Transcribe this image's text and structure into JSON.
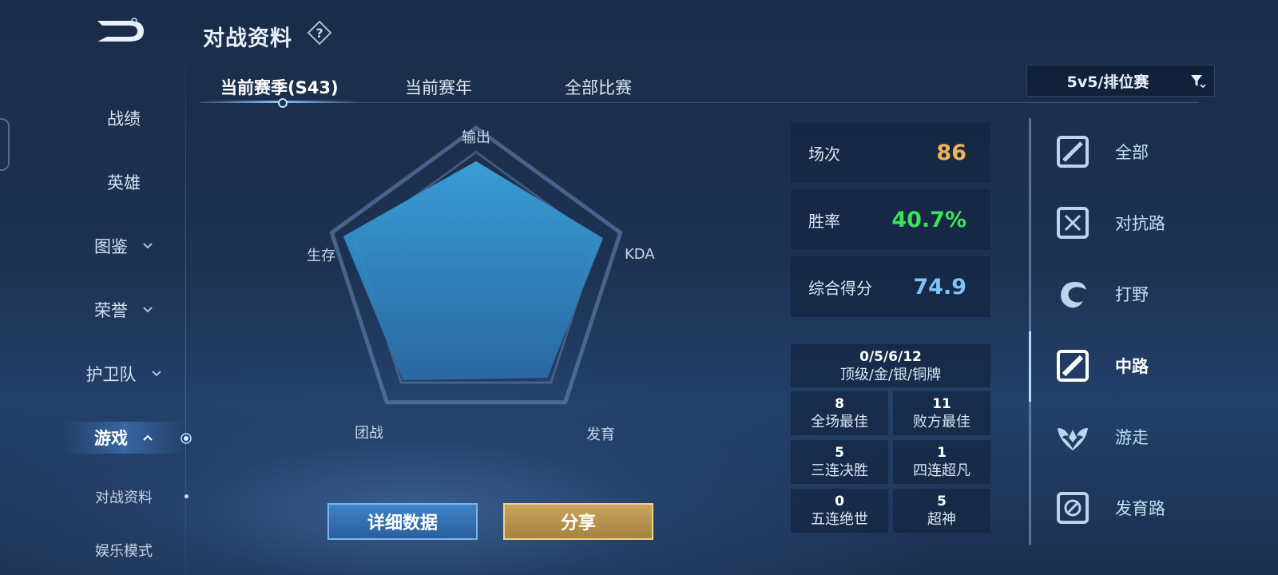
{
  "header": {
    "title": "对战资料"
  },
  "nav": {
    "items": [
      {
        "label": "战绩"
      },
      {
        "label": "英雄"
      },
      {
        "label": "图鉴"
      },
      {
        "label": "荣誉"
      },
      {
        "label": "护卫队"
      },
      {
        "label": "游戏"
      }
    ],
    "sub_items": [
      {
        "label": "对战资料"
      },
      {
        "label": "娱乐模式"
      }
    ]
  },
  "tabs": [
    {
      "label": "当前赛季(S43)"
    },
    {
      "label": "当前赛年"
    },
    {
      "label": "全部比赛"
    }
  ],
  "filter": {
    "label": "5v5/排位赛"
  },
  "radar": {
    "axes": [
      "输出",
      "KDA",
      "发育",
      "团战",
      "生存"
    ],
    "values": [
      0.78,
      0.88,
      0.8,
      0.82,
      0.92
    ]
  },
  "stats": {
    "matches": {
      "label": "场次",
      "value": "86"
    },
    "win_rate": {
      "label": "胜率",
      "value": "40.7%"
    },
    "score": {
      "label": "综合得分",
      "value": "74.9"
    }
  },
  "medals": {
    "counts": "0/5/6/12",
    "label": "顶级/金/银/铜牌"
  },
  "achievements": [
    {
      "count": "8",
      "label": "全场最佳"
    },
    {
      "count": "11",
      "label": "败方最佳"
    },
    {
      "count": "5",
      "label": "三连决胜"
    },
    {
      "count": "1",
      "label": "四连超凡"
    },
    {
      "count": "0",
      "label": "五连绝世"
    },
    {
      "count": "5",
      "label": "超神"
    }
  ],
  "buttons": {
    "details": "详细数据",
    "share": "分享"
  },
  "lanes": [
    {
      "label": "全部"
    },
    {
      "label": "对抗路"
    },
    {
      "label": "打野"
    },
    {
      "label": "中路"
    },
    {
      "label": "游走"
    },
    {
      "label": "发育路"
    }
  ],
  "colors": {
    "matches": "#f0b35a",
    "win_rate": "#3be35b",
    "score": "#7ec3f5"
  }
}
